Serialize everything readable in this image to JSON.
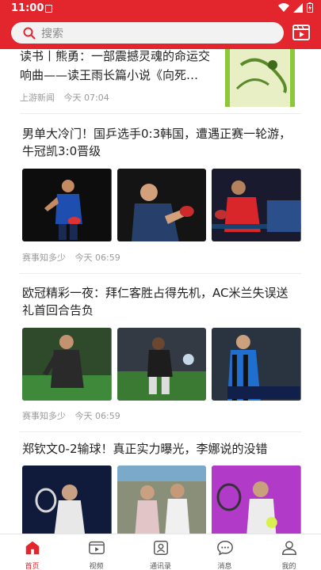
{
  "status_bar": {
    "time": "11:00"
  },
  "search": {
    "placeholder": "搜索"
  },
  "feed": {
    "articles": [
      {
        "title": "读书丨熊勇：一部震撼灵魂的命运交响曲——读王雨长篇小说《向死…",
        "source": "上游新闻",
        "time": "今天 07:04"
      },
      {
        "title": "男单大冷门！国乒选手0:3韩国，遭遇正赛一轮游，牛冠凯3:0晋级",
        "source": "赛事知多少",
        "time": "今天 06:59"
      },
      {
        "title": "欧冠精彩一夜：拜仁客胜占得先机，AC米兰失误送礼首回合告负",
        "source": "赛事知多少",
        "time": "今天 06:59"
      },
      {
        "title": "郑钦文0-2输球！真正实力曝光，李娜说的没错"
      }
    ]
  },
  "tabbar": {
    "items": [
      {
        "label": "首页",
        "icon": "home-icon",
        "active": true
      },
      {
        "label": "视频",
        "icon": "video-icon",
        "active": false
      },
      {
        "label": "通讯录",
        "icon": "contacts-icon",
        "active": false
      },
      {
        "label": "消息",
        "icon": "message-icon",
        "active": false
      },
      {
        "label": "我的",
        "icon": "profile-icon",
        "active": false
      }
    ]
  },
  "colors": {
    "brand": "#e3262d",
    "meta": "#9a9a9a"
  }
}
